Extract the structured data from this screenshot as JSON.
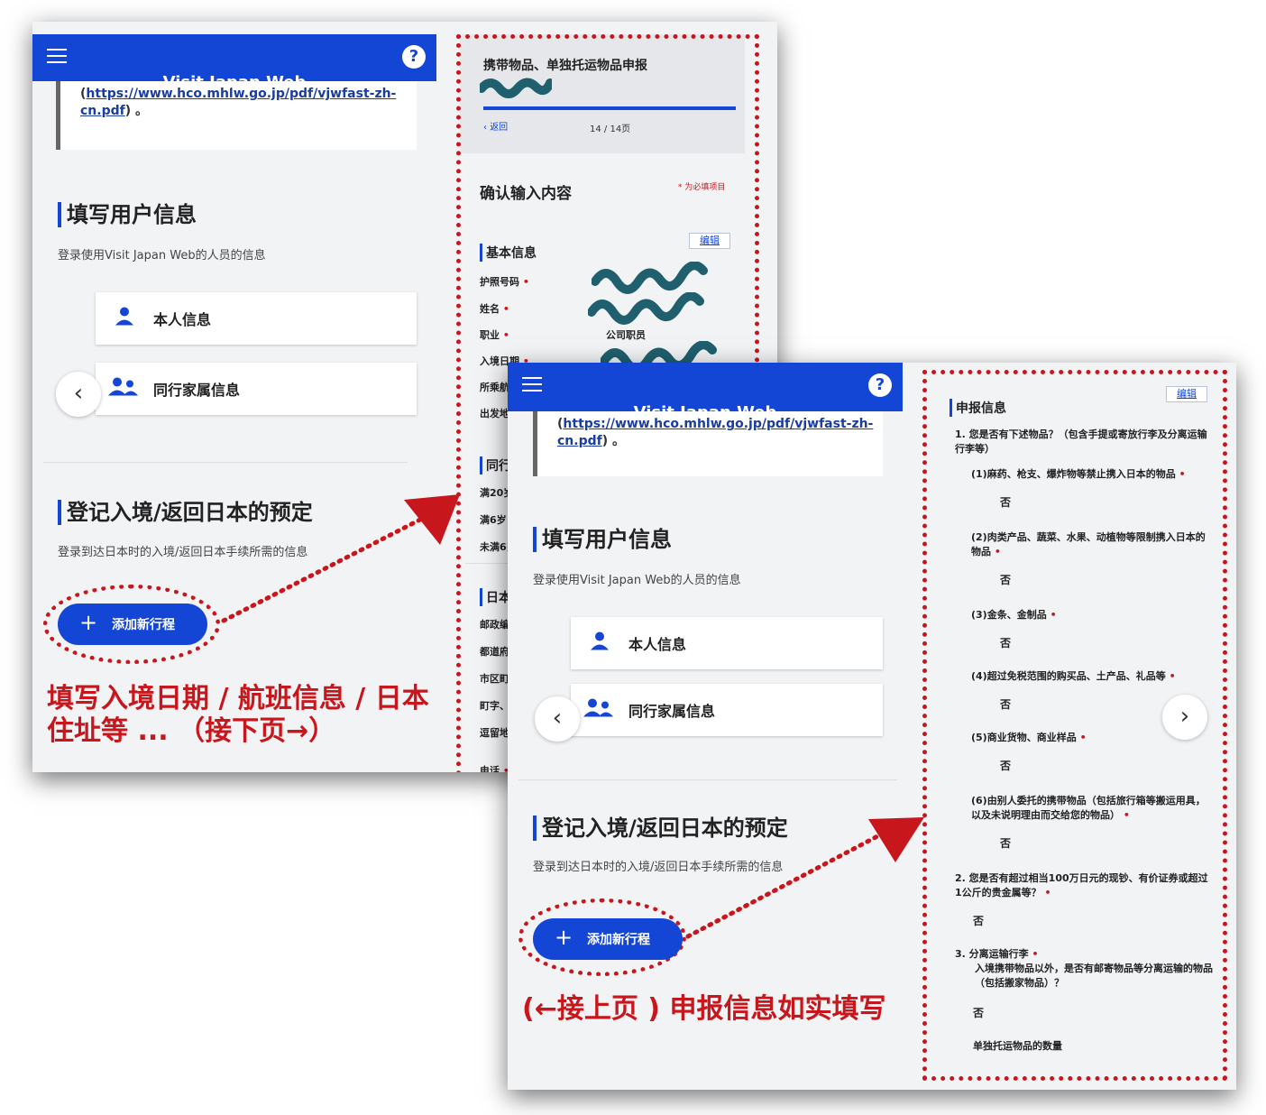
{
  "app_title": "Visit Japan Web",
  "link_url": "https://www.hco.mhlw.go.jp/pdf/vjwfast-zh-cn.pdf",
  "link": {
    "open_paren": "(",
    "line1": "https://www.hco.mhlw.go.jp/pdf/vjwfast-zh-",
    "line2": "cn.pdf",
    "close": ") 。"
  },
  "user_section": {
    "title": "填写用户信息",
    "desc": "登录使用Visit Japan Web的人员的信息",
    "self_btn": "本人信息",
    "family_btn": "同行家属信息"
  },
  "plan_section": {
    "title": "登记入境/返回日本的预定",
    "desc": "登录到达日本时的入境/返回日本手续所需的信息",
    "add_btn": "添加新行程"
  },
  "captions": {
    "card1_line1": "填写入境日期 / 航班信息 / 日本",
    "card1_line2": "住址等 ... （接下页→）",
    "card2": "(←接上页 ) 申报信息如实填写"
  },
  "declaration": {
    "title": "携带物品、单独托运物品申报",
    "back": "返回",
    "page": "14 / 14页",
    "confirm_title": "确认输入内容",
    "required_note": "* 为必填项目",
    "basic_info": {
      "title": "基本信息",
      "edit": "编辑",
      "fields": [
        "护照号码",
        "姓名",
        "职业",
        "入境日期",
        "所乘航班(船)名称",
        "出发地"
      ],
      "occupation_value": "公司职员"
    },
    "companions_title": "同行",
    "companion_rows": [
      "满20岁",
      "满6岁",
      "未满6岁"
    ],
    "address_title": "日本",
    "address_rows": [
      "邮政编码",
      "都道府县",
      "市区町村",
      "町字、番地",
      "逗留地",
      "电话"
    ]
  },
  "report": {
    "title": "申报信息",
    "edit": "编辑",
    "q1": "1.  您是否有下述物品？（包含手提或寄放行李及分离运输行李等）",
    "items": [
      {
        "label": "(1)麻药、枪支、爆炸物等禁止携入日本的物品",
        "answer": "否"
      },
      {
        "label": "(2)肉类产品、蔬菜、水果、动植物等限制携入日本的物品",
        "answer": "否"
      },
      {
        "label": "(3)金条、金制品",
        "answer": "否"
      },
      {
        "label": "(4)超过免税范围的购买品、土产品、礼品等",
        "answer": "否"
      },
      {
        "label": "(5)商业货物、商业样品",
        "answer": "否"
      },
      {
        "label": "(6)由别人委托的携带物品（包括旅行箱等搬运用具，以及未说明理由而交给您的物品）",
        "answer": "否"
      }
    ],
    "q2": "2.  您是否有超过相当100万日元的现钞、有价证券或超过1公斤的贵金属等？",
    "q2_answer": "否",
    "q3_title": "3.  分离运输行李",
    "q3_body": "入境携带物品以外，是否有邮寄物品等分离运输的物品（包括搬家物品）？",
    "q3_answer": "否",
    "separate_count_label": "单独托运物品的数量"
  },
  "icons": {
    "menu": "menu-icon",
    "help": "help-icon",
    "person": "person-icon",
    "group": "group-icon",
    "prev": "chevron-left-icon",
    "next": "chevron-right-icon",
    "plus": "plus-icon"
  },
  "colors": {
    "brand_blue": "#1446d6",
    "annotation_red": "#c8171c",
    "redaction_teal": "#1f5f6e"
  }
}
